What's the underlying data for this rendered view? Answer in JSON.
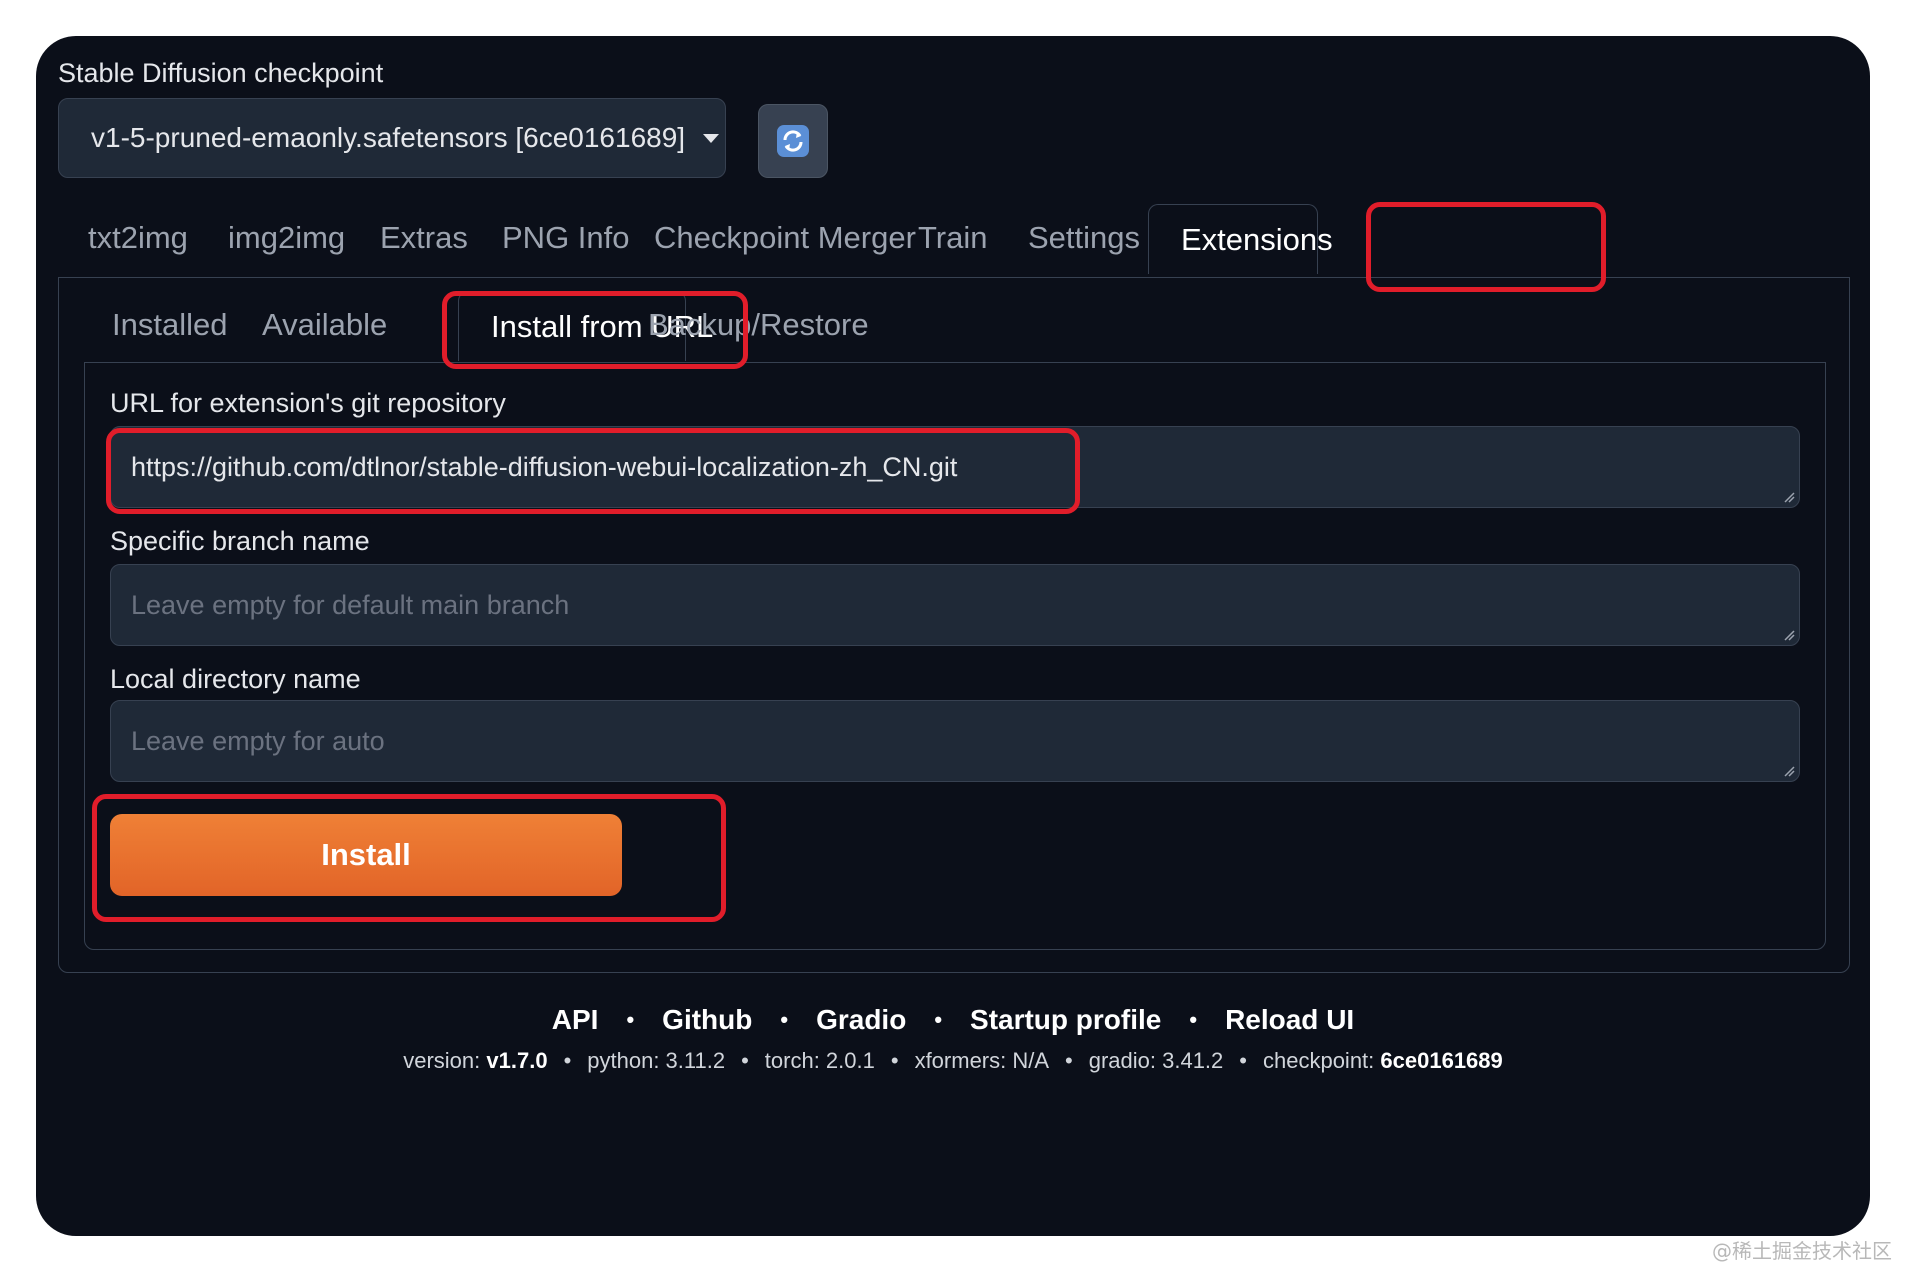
{
  "checkpoint": {
    "label": "Stable Diffusion checkpoint",
    "selected": "v1-5-pruned-emaonly.safetensors [6ce0161689]",
    "refresh_icon": "refresh-icon"
  },
  "tabs": [
    {
      "label": "txt2img"
    },
    {
      "label": "img2img"
    },
    {
      "label": "Extras"
    },
    {
      "label": "PNG Info"
    },
    {
      "label": "Checkpoint Merger"
    },
    {
      "label": "Train"
    },
    {
      "label": "Settings"
    },
    {
      "label": "Extensions",
      "active": true
    }
  ],
  "subtabs": [
    {
      "label": "Installed"
    },
    {
      "label": "Available"
    },
    {
      "label": "Install from URL",
      "active": true
    },
    {
      "label": "Backup/Restore"
    }
  ],
  "form": {
    "url": {
      "label": "URL for extension's git repository",
      "value": "https://github.com/dtlnor/stable-diffusion-webui-localization-zh_CN.git"
    },
    "branch": {
      "label": "Specific branch name",
      "placeholder": "Leave empty for default main branch"
    },
    "dir": {
      "label": "Local directory name",
      "placeholder": "Leave empty for auto"
    },
    "install_label": "Install"
  },
  "footer": {
    "links": [
      "API",
      "Github",
      "Gradio",
      "Startup profile",
      "Reload UI"
    ],
    "info": {
      "version_label": "version:",
      "version": "v1.7.0",
      "python": "python: 3.11.2",
      "torch": "torch: 2.0.1",
      "xformers": "xformers: N/A",
      "gradio": "gradio: 3.41.2",
      "checkpoint_label": "checkpoint:",
      "checkpoint": "6ce0161689"
    }
  },
  "watermark": "@稀土掘金技术社区",
  "colors": {
    "accent": "#e8702e",
    "highlight": "#e11d2a",
    "background": "#0b0f19"
  }
}
